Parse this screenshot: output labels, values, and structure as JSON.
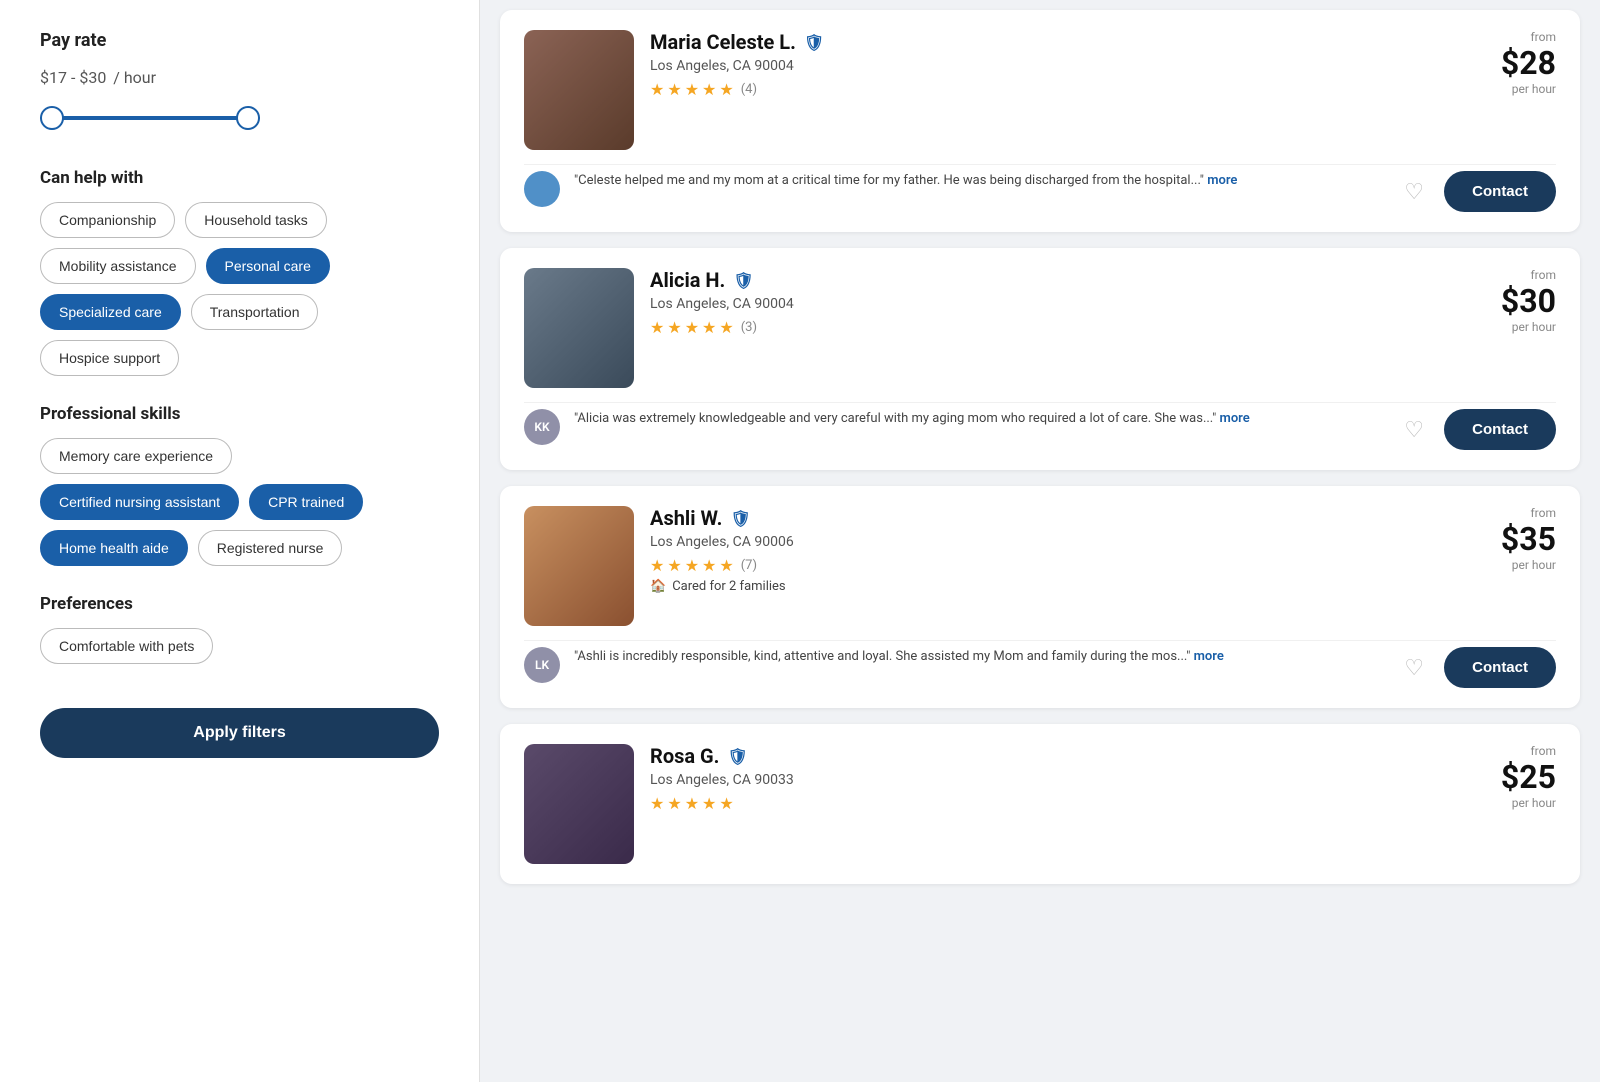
{
  "sidebar": {
    "pay_rate_label": "Pay rate",
    "pay_rate_value": "$17 - $30",
    "pay_rate_unit": "/ hour",
    "slider_min": 17,
    "slider_max": 30,
    "can_help_title": "Can help with",
    "can_help_tags": [
      {
        "label": "Companionship",
        "active": false
      },
      {
        "label": "Household tasks",
        "active": false
      },
      {
        "label": "Mobility assistance",
        "active": false
      },
      {
        "label": "Personal care",
        "active": true
      },
      {
        "label": "Specialized care",
        "active": true
      },
      {
        "label": "Transportation",
        "active": false
      },
      {
        "label": "Hospice support",
        "active": false
      }
    ],
    "prof_skills_title": "Professional skills",
    "prof_skills_tags": [
      {
        "label": "Memory care experience",
        "active": false
      },
      {
        "label": "Certified nursing assistant",
        "active": true
      },
      {
        "label": "CPR trained",
        "active": true
      },
      {
        "label": "Home health aide",
        "active": true
      },
      {
        "label": "Registered nurse",
        "active": false
      }
    ],
    "preferences_title": "Preferences",
    "preferences_tags": [
      {
        "label": "Comfortable with pets",
        "active": false
      }
    ],
    "apply_btn_label": "Apply filters"
  },
  "caregivers": [
    {
      "name": "Maria Celeste L.",
      "verified": true,
      "location": "Los Angeles, CA 90004",
      "stars": 5,
      "review_count": "(4)",
      "families_text": "",
      "price_from": "from",
      "price": "$28",
      "price_per": "per hour",
      "photo_class": "brown",
      "reviewer_initials": "",
      "reviewer_class": "blue",
      "review_text": "\"Celeste helped me and my mom at a critical time for my father. He was being discharged from the hospital...\"",
      "more_label": "more"
    },
    {
      "name": "Alicia H.",
      "verified": true,
      "location": "Los Angeles, CA 90004",
      "stars": 5,
      "review_count": "(3)",
      "families_text": "",
      "price_from": "from",
      "price": "$30",
      "price_per": "per hour",
      "photo_class": "dark",
      "reviewer_initials": "KK",
      "reviewer_class": "gray",
      "review_text": "\"Alicia was extremely knowledgeable and very careful with my aging mom who required a lot of care. She was...\"",
      "more_label": "more"
    },
    {
      "name": "Ashli W.",
      "verified": true,
      "location": "Los Angeles, CA 90006",
      "stars": 5,
      "review_count": "(7)",
      "families_text": "Cared for 2 families",
      "price_from": "from",
      "price": "$35",
      "price_per": "per hour",
      "photo_class": "warm",
      "reviewer_initials": "LK",
      "reviewer_class": "gray",
      "review_text": "\"Ashli is incredibly responsible, kind, attentive and loyal. She assisted my Mom and family during the mos...\"",
      "more_label": "more"
    },
    {
      "name": "Rosa G.",
      "verified": true,
      "location": "Los Angeles, CA 90033",
      "stars": 5,
      "review_count": "",
      "families_text": "",
      "price_from": "from",
      "price": "$25",
      "price_per": "per hour",
      "photo_class": "dark2",
      "reviewer_initials": "",
      "reviewer_class": "gray",
      "review_text": "",
      "more_label": ""
    }
  ],
  "ui": {
    "contact_label": "Contact",
    "heart_symbol": "♡",
    "star_symbol": "★",
    "shield_symbol": "🛡",
    "home_symbol": "🏠"
  }
}
